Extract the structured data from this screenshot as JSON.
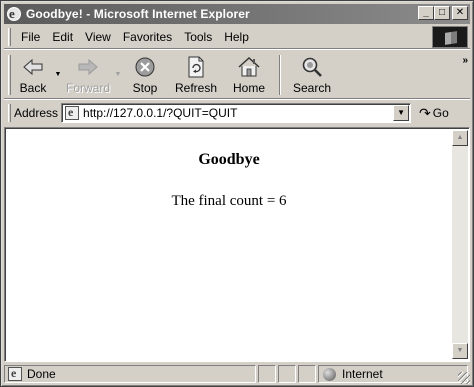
{
  "window": {
    "title": "Goodbye! - Microsoft Internet Explorer",
    "minimize": "_",
    "maximize": "□",
    "close": "✕"
  },
  "menu": {
    "items": [
      {
        "label": "File"
      },
      {
        "label": "Edit"
      },
      {
        "label": "View"
      },
      {
        "label": "Favorites"
      },
      {
        "label": "Tools"
      },
      {
        "label": "Help"
      }
    ]
  },
  "toolbar": {
    "back": "Back",
    "forward": "Forward",
    "stop": "Stop",
    "refresh": "Refresh",
    "home": "Home",
    "search": "Search",
    "more": "»"
  },
  "address": {
    "label": "Address",
    "url": "http://127.0.0.1/?QUIT=QUIT",
    "go": "Go"
  },
  "page": {
    "heading": "Goodbye",
    "message": "The final count = 6"
  },
  "status": {
    "text": "Done",
    "zone": "Internet"
  },
  "icons": {
    "back": "back-arrow-icon",
    "forward": "forward-arrow-icon",
    "stop": "stop-icon",
    "refresh": "refresh-icon",
    "home": "home-icon",
    "search": "search-icon",
    "page": "ie-page-icon",
    "zone": "internet-zone-icon"
  }
}
